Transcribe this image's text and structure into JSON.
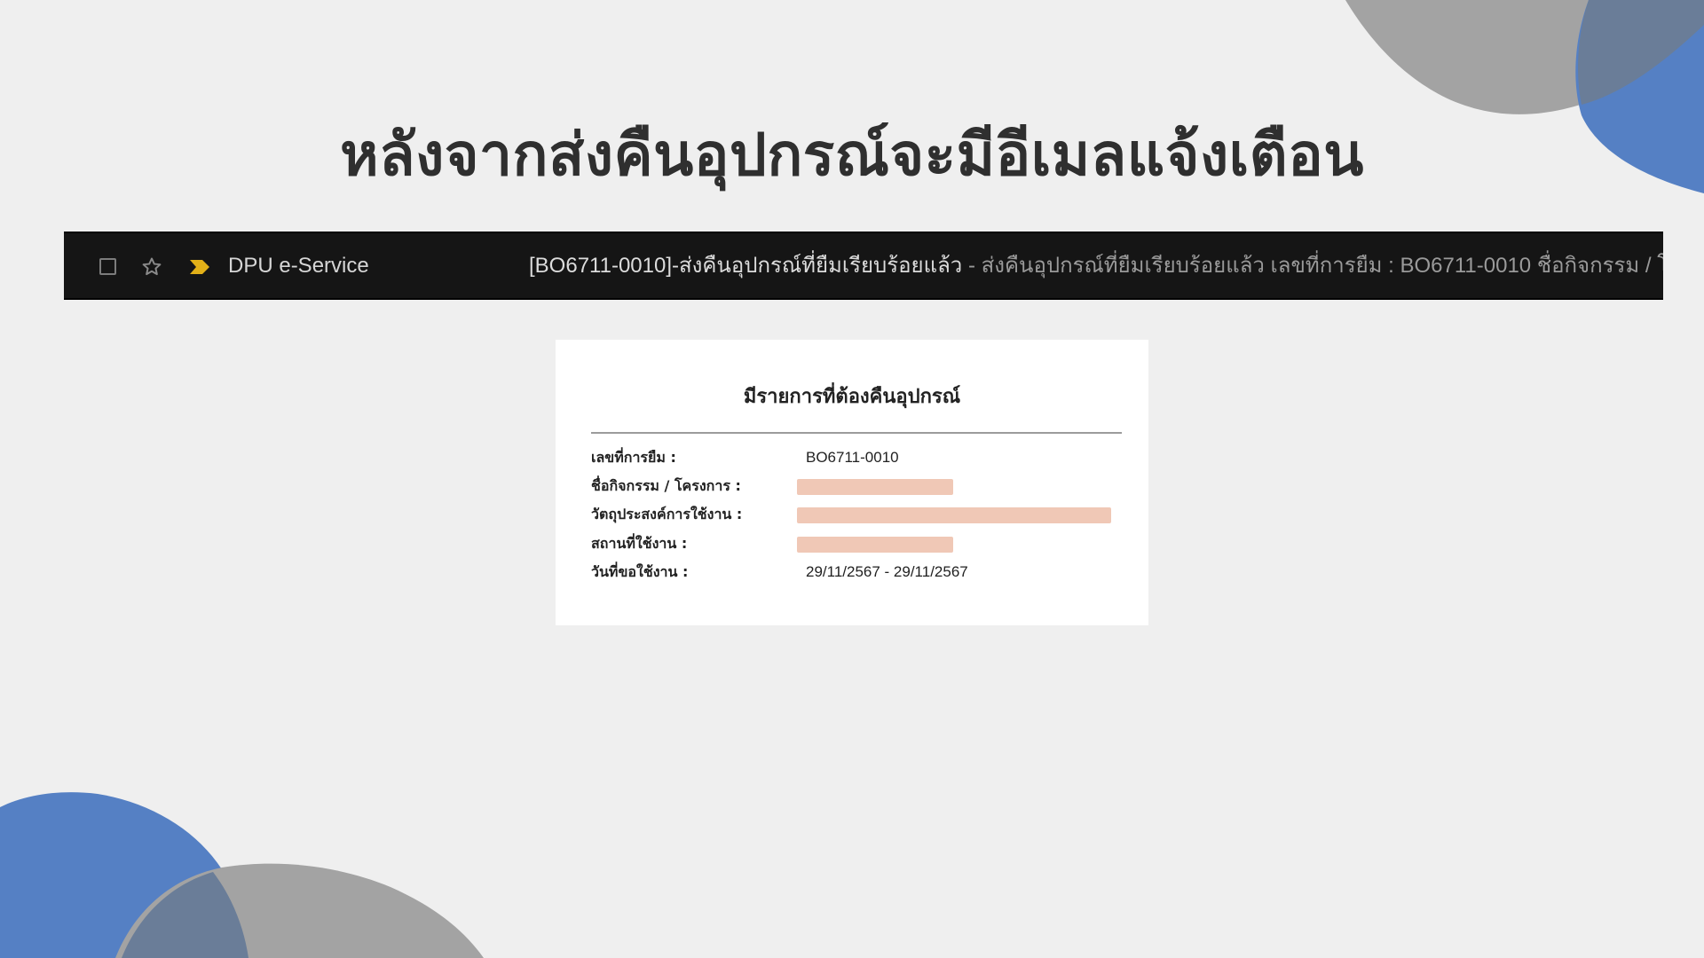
{
  "slide": {
    "title": "หลังจากส่งคืนอุปกรณ์จะมีอีเมลแจ้งเตือน"
  },
  "colors": {
    "background": "#efefef",
    "blob_gray": "#a3a3a3",
    "blob_blue": "#5580c4",
    "blob_overlap": "#6a7d98",
    "mail_row_bg": "#151515",
    "importance_marker": "#e2b018",
    "redaction": "#efc5b2"
  },
  "mail_row": {
    "checkbox_icon": "checkbox-empty-icon",
    "star_icon": "star-outline-icon",
    "importance_icon": "importance-marker-icon",
    "sender": "DPU e-Service",
    "subject": "[BO6711-0010]-ส่งคืนอุปกรณ์ที่ยืมเรียบร้อยแล้ว",
    "separator": " - ",
    "snippet": "ส่งคืนอุปกรณ์ที่ยืมเรียบร้อยแล้ว เลขที่การยืม : BO6711-0010 ชื่อกิจกรรม / โครงการ"
  },
  "email_card": {
    "heading": "มีรายการที่ต้องคืนอุปกรณ์",
    "fields": [
      {
        "label": "เลขที่การยืม :",
        "value": "BO6711-0010"
      },
      {
        "label": "ชื่อกิจกรรม / โครงการ :",
        "value": ""
      },
      {
        "label": "วัตถุประสงค์การใช้งาน :",
        "value": ""
      },
      {
        "label": "สถานที่ใช้งาน :",
        "value": ""
      },
      {
        "label": "วันที่ขอใช้งาน :",
        "value": "29/11/2567 - 29/11/2567"
      }
    ]
  }
}
